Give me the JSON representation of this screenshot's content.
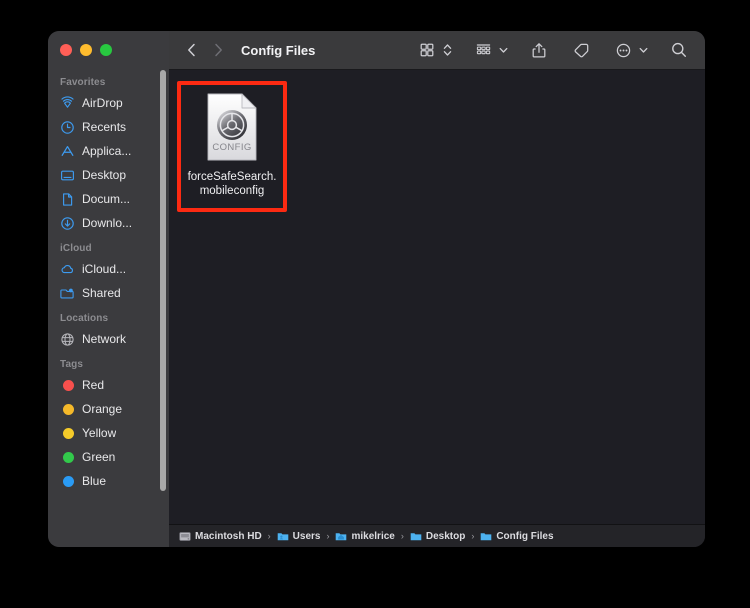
{
  "window": {
    "title": "Config Files",
    "traffic_lights": [
      {
        "name": "close",
        "color": "#ff5f57"
      },
      {
        "name": "minimize",
        "color": "#febc2e"
      },
      {
        "name": "maximize",
        "color": "#28c840"
      }
    ]
  },
  "toolbar": {
    "back_label": "Back",
    "forward_label": "Forward",
    "icons": [
      {
        "name": "icon-view-button",
        "label": "Icon View"
      },
      {
        "name": "view-options-chevron",
        "label": "View Options"
      },
      {
        "name": "group-by-button",
        "label": "Group Items"
      },
      {
        "name": "group-by-chevron",
        "label": "Group Options"
      },
      {
        "name": "share-button",
        "label": "Share"
      },
      {
        "name": "tag-button",
        "label": "Add Tags"
      },
      {
        "name": "more-actions-button",
        "label": "More"
      },
      {
        "name": "more-actions-chevron",
        "label": "More Options"
      },
      {
        "name": "search-button",
        "label": "Search"
      }
    ]
  },
  "sidebar": {
    "sections": [
      {
        "title": "Favorites",
        "items": [
          {
            "label": "AirDrop",
            "icon": "airdrop-icon"
          },
          {
            "label": "Recents",
            "icon": "clock-icon"
          },
          {
            "label": "Applica...",
            "icon": "applications-icon"
          },
          {
            "label": "Desktop",
            "icon": "desktop-icon"
          },
          {
            "label": "Docum...",
            "icon": "document-icon"
          },
          {
            "label": "Downlo...",
            "icon": "downloads-icon"
          }
        ]
      },
      {
        "title": "iCloud",
        "items": [
          {
            "label": "iCloud...",
            "icon": "cloud-icon"
          },
          {
            "label": "Shared",
            "icon": "shared-folder-icon"
          }
        ]
      },
      {
        "title": "Locations",
        "items": [
          {
            "label": "Network",
            "icon": "globe-icon"
          }
        ]
      },
      {
        "title": "Tags",
        "items": [
          {
            "label": "Red",
            "icon": "tag-dot",
            "color": "#f8504d"
          },
          {
            "label": "Orange",
            "icon": "tag-dot",
            "color": "#f5b92a"
          },
          {
            "label": "Yellow",
            "icon": "tag-dot",
            "color": "#f5cb2a"
          },
          {
            "label": "Green",
            "icon": "tag-dot",
            "color": "#32c94b"
          },
          {
            "label": "Blue",
            "icon": "tag-dot",
            "color": "#2a9bf5"
          }
        ]
      }
    ]
  },
  "content": {
    "files": [
      {
        "name_line1": "forceSafeSearch.",
        "name_line2": "mobileconfig",
        "icon_type": "config-file-icon",
        "icon_badge": "CONFIG",
        "highlighted": true,
        "highlight_color": "#fc2a12"
      }
    ]
  },
  "pathbar": {
    "crumbs": [
      {
        "label": "Macintosh HD",
        "icon": "harddisk-icon"
      },
      {
        "label": "Users",
        "icon": "users-folder-icon"
      },
      {
        "label": "mikelrice",
        "icon": "home-folder-icon"
      },
      {
        "label": "Desktop",
        "icon": "desktop-folder-icon"
      },
      {
        "label": "Config Files",
        "icon": "folder-icon"
      }
    ],
    "separator": "›"
  }
}
